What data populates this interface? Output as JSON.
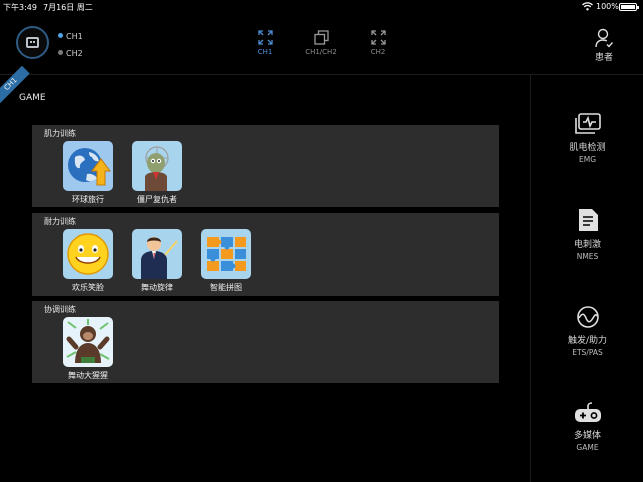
{
  "status_bar": {
    "time": "下午3:49",
    "date": "7月16日 周二",
    "battery": "100%"
  },
  "header": {
    "channels": [
      {
        "label": "CH1"
      },
      {
        "label": "CH2"
      }
    ],
    "modes": [
      {
        "label": "CH1"
      },
      {
        "label": "CH1/CH2"
      },
      {
        "label": "CH2"
      }
    ],
    "patient_label": "患者"
  },
  "main": {
    "corner_tag": "CH1",
    "title": "GAME",
    "sections": [
      {
        "title": "肌力训练",
        "apps": [
          {
            "label": "环球旅行"
          },
          {
            "label": "僵尸复仇者"
          }
        ]
      },
      {
        "title": "耐力训练",
        "apps": [
          {
            "label": "欢乐笑脸"
          },
          {
            "label": "舞动旋律"
          },
          {
            "label": "智能拼图"
          }
        ]
      },
      {
        "title": "协调训练",
        "apps": [
          {
            "label": "舞动大猩猩"
          }
        ]
      }
    ]
  },
  "sidebar": {
    "items": [
      {
        "zh": "肌电检测",
        "en": "EMG"
      },
      {
        "zh": "电刺激",
        "en": "NMES"
      },
      {
        "zh": "触发/助力",
        "en": "ETS/PAS"
      },
      {
        "zh": "多媒体",
        "en": "GAME"
      }
    ]
  },
  "colors": {
    "accent": "#4d8fd6",
    "section_bg": "#2d2d2d",
    "background": "#000000"
  }
}
